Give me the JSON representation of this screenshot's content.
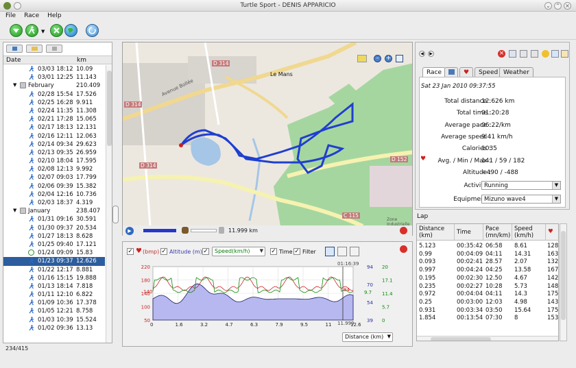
{
  "window": {
    "title": "Turtle Sport - DENIS APPARICIO"
  },
  "menu": [
    "File",
    "Race",
    "Help"
  ],
  "sidebar": {
    "columns": {
      "date": "Date",
      "km": "km"
    },
    "rows": [
      {
        "type": "run",
        "date": "03/03 18:12",
        "km": "10.09"
      },
      {
        "type": "run",
        "date": "03/01 12:25",
        "km": "11.143"
      },
      {
        "type": "folder",
        "date": "February",
        "km": "210.409"
      },
      {
        "type": "run",
        "date": "02/28 15:54",
        "km": "17.526"
      },
      {
        "type": "run",
        "date": "02/25 16:28",
        "km": "9.911"
      },
      {
        "type": "run",
        "date": "02/24 11:35",
        "km": "11.308"
      },
      {
        "type": "run",
        "date": "02/21 17:28",
        "km": "15.065"
      },
      {
        "type": "run",
        "date": "02/17 18:13",
        "km": "12.131"
      },
      {
        "type": "run",
        "date": "02/16 12:11",
        "km": "12.063"
      },
      {
        "type": "run",
        "date": "02/14 09:34",
        "km": "29.623"
      },
      {
        "type": "run",
        "date": "02/13 09:35",
        "km": "26.959"
      },
      {
        "type": "run",
        "date": "02/10 18:04",
        "km": "17.595"
      },
      {
        "type": "run",
        "date": "02/08 12:13",
        "km": "9.992"
      },
      {
        "type": "run",
        "date": "02/07 09:03",
        "km": "17.799"
      },
      {
        "type": "run",
        "date": "02/06 09:39",
        "km": "15.382"
      },
      {
        "type": "run",
        "date": "02/04 12:16",
        "km": "10.736"
      },
      {
        "type": "run",
        "date": "02/03 18:37",
        "km": "4.319"
      },
      {
        "type": "folder",
        "date": "January",
        "km": "238.407"
      },
      {
        "type": "run",
        "date": "01/31 09:16",
        "km": "30.591"
      },
      {
        "type": "run",
        "date": "01/30 09:37",
        "km": "20.534"
      },
      {
        "type": "run",
        "date": "01/27 18:13",
        "km": "8.628"
      },
      {
        "type": "run",
        "date": "01/25 09:40",
        "km": "17.121"
      },
      {
        "type": "bike",
        "date": "01/24 09:09",
        "km": "15.83"
      },
      {
        "type": "run",
        "date": "01/23 09:37",
        "km": "12.626",
        "selected": true
      },
      {
        "type": "run",
        "date": "01/22 12:17",
        "km": "8.881"
      },
      {
        "type": "run",
        "date": "01/16 15:15",
        "km": "19.888"
      },
      {
        "type": "run",
        "date": "01/13 18:14",
        "km": "7.818"
      },
      {
        "type": "run",
        "date": "01/11 12:10",
        "km": "6.822"
      },
      {
        "type": "run",
        "date": "01/09 10:36",
        "km": "17.378"
      },
      {
        "type": "run",
        "date": "01/05 12:21",
        "km": "8.758"
      },
      {
        "type": "run",
        "date": "01/03 10:39",
        "km": "15.524"
      },
      {
        "type": "run",
        "date": "01/02 09:36",
        "km": "13.13"
      }
    ],
    "status": "234/415"
  },
  "map": {
    "labels": [
      "D 314",
      "Le Mans",
      "D 314",
      "D 314",
      "D 152",
      "C 115",
      "Avenue Bollée",
      "Zone Industrielle"
    ],
    "distance": "11.999 km"
  },
  "graph": {
    "toggles": {
      "hr": "(bmp)",
      "alt": "Altitude (m)",
      "speed": "Speed(km/h)",
      "time": "Time",
      "filter": "Filter"
    },
    "xaxis_select": "Distance (km)",
    "cursor_time": "01:16:39",
    "cursor_dist": "11.999",
    "hr_ticks": [
      "220",
      "180",
      "140",
      "100",
      "50"
    ],
    "alt_ticks": [
      "94",
      "70",
      "54",
      "39"
    ],
    "speed_ticks": [
      "20",
      "17.1",
      "11.4",
      "5.7",
      "0"
    ],
    "x_ticks": [
      "0",
      "1.6",
      "3.2",
      "4.7",
      "6.3",
      "7.9",
      "9.5",
      "11",
      "12.6"
    ],
    "markers": {
      "hr": "140",
      "speed": "9.7"
    },
    "alt_right_marker": "84"
  },
  "race": {
    "date": "Sat 23 Jan 2010 09:37:55",
    "tabs": [
      "Race",
      "Speed",
      "Weather"
    ],
    "fields": [
      {
        "label": "Total distance :",
        "value": "12.626 km"
      },
      {
        "label": "Total time :",
        "value": "01:20:28"
      },
      {
        "label": "Average pace :",
        "value": "06:22/km"
      },
      {
        "label": "Average speed :",
        "value": "9.41 km/h"
      },
      {
        "label": "Calories :",
        "value": "1035"
      },
      {
        "label": "Avg. / Min / Max :",
        "value": "141 / 59 / 182"
      },
      {
        "label": "Altitude :",
        "value": "+490 / -488"
      }
    ],
    "activity_label": "Activity :",
    "activity": "Running",
    "equipment_label": "Equipment :",
    "equipment": "Mizuno wave4"
  },
  "lap": {
    "title": "Lap",
    "headers": [
      "Distance (km)",
      "Time",
      "Pace (mn/km)",
      "Speed (km/h)",
      ""
    ],
    "rows": [
      [
        "5.123",
        "00:35:42",
        "06:58",
        "8.61",
        "128"
      ],
      [
        "0.99",
        "00:04:09",
        "04:11",
        "14.31",
        "163"
      ],
      [
        "0.093",
        "00:02:41",
        "28.57",
        "2.07",
        "132"
      ],
      [
        "0.997",
        "00:04:24",
        "04:25",
        "13.58",
        "167"
      ],
      [
        "0.195",
        "00:02:30",
        "12.50",
        "4.67",
        "142"
      ],
      [
        "0.235",
        "00:02:27",
        "10:28",
        "5.73",
        "148"
      ],
      [
        "0.972",
        "00:04:04",
        "04:11",
        "14.3",
        "175"
      ],
      [
        "0.25",
        "00:03:00",
        "12:03",
        "4.98",
        "143"
      ],
      [
        "0.931",
        "00:03:34",
        "03:50",
        "15.64",
        "175"
      ],
      [
        "1.854",
        "00:13:54",
        "07:30",
        "8",
        "153"
      ]
    ]
  },
  "colors": {
    "selected": "#2c5d9e",
    "hr": "#cc2222",
    "alt_fill": "#b8b8f0",
    "speed": "#0a8a0a",
    "track": "#1f3fd0",
    "forest": "#a6d6a0"
  }
}
